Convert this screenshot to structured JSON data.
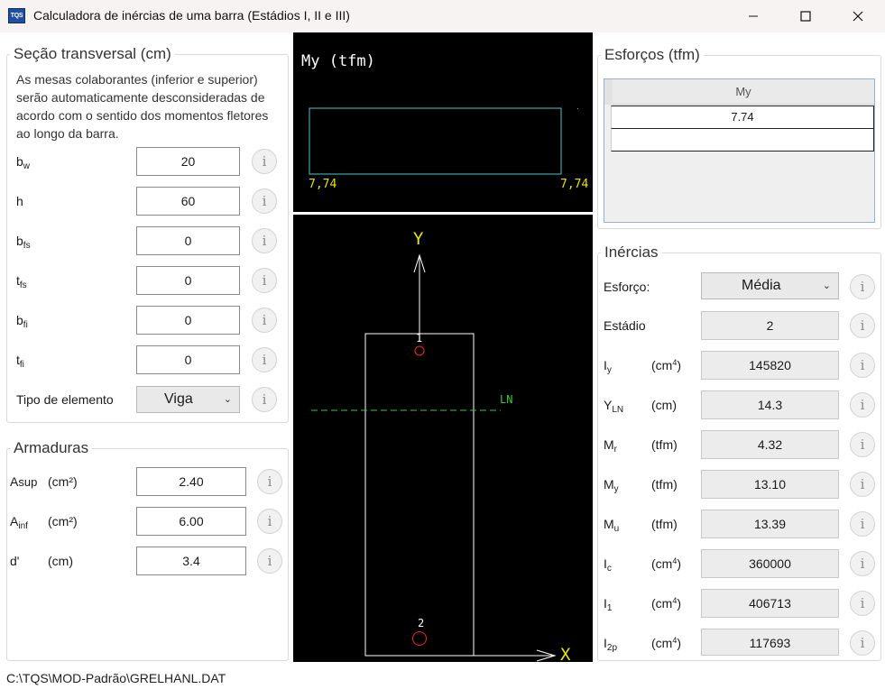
{
  "window": {
    "title": "Calculadora de inércias de uma barra (Estádios I, II e III)",
    "icon_text": "TQS"
  },
  "secao": {
    "title": "Seção transversal (cm)",
    "description": [
      "As mesas colaborantes (inferior e superior)",
      "serão automaticamente desconsideradas de",
      "acordo com o sentido dos momentos fletores",
      "ao longo da barra."
    ],
    "fields": [
      {
        "base": "b",
        "sub": "w",
        "value": "20"
      },
      {
        "base": "h",
        "sub": "",
        "value": "60"
      },
      {
        "base": "b",
        "sub": "fs",
        "value": "0"
      },
      {
        "base": "t",
        "sub": "fs",
        "value": "0"
      },
      {
        "base": "b",
        "sub": "fi",
        "value": "0"
      },
      {
        "base": "t",
        "sub": "fi",
        "value": "0"
      }
    ],
    "tipo_label": "Tipo de elemento",
    "tipo_value": "Viga"
  },
  "armaduras": {
    "title": "Armaduras",
    "rows": [
      {
        "base": "A",
        "sub": "sup",
        "unit": "(cm²)",
        "value": "2.40"
      },
      {
        "base": "A",
        "sub": "inf",
        "unit": "(cm²)",
        "value": "6.00"
      },
      {
        "base": "d'",
        "sub": "",
        "unit": "(cm)",
        "value": "3.4"
      }
    ]
  },
  "diagram": {
    "title": "My (tfm)",
    "left_value": "7,74",
    "right_value": "7,74"
  },
  "section_view": {
    "y_label": "Y",
    "x_label": "X",
    "ln_label": "LN",
    "point1": "1",
    "point2": "2"
  },
  "esforcos": {
    "title": "Esforços (tfm)",
    "column": "My",
    "value": "7.74"
  },
  "inercias": {
    "title": "Inércias",
    "esforco_label": "Esforço:",
    "esforco_value": "Média",
    "estadio_label": "Estádio",
    "estadio_value": "2",
    "rows": [
      {
        "base": "I",
        "sub": "y",
        "unit": "(cm",
        "unit_sup": "4",
        "value": "145820"
      },
      {
        "base": "Y",
        "sub": "LN",
        "unit": "(cm)",
        "unit_sup": "",
        "value": "14.3"
      },
      {
        "base": "M",
        "sub": "r",
        "unit": "(tfm)",
        "unit_sup": "",
        "value": "4.32"
      },
      {
        "base": "M",
        "sub": "y",
        "unit": "(tfm)",
        "unit_sup": "",
        "value": "13.10"
      },
      {
        "base": "M",
        "sub": "u",
        "unit": "(tfm)",
        "unit_sup": "",
        "value": "13.39"
      },
      {
        "base": "I",
        "sub": "c",
        "unit": "(cm",
        "unit_sup": "4",
        "value": "360000"
      },
      {
        "base": "I",
        "sub": "1",
        "unit": "(cm",
        "unit_sup": "4",
        "value": "406713"
      },
      {
        "base": "I",
        "sub": "2p",
        "unit": "(cm",
        "unit_sup": "4",
        "value": "117693"
      }
    ]
  },
  "status_path": "C:\\TQS\\MOD-Padrão\\GRELHANL.DAT",
  "icons": [
    "app-icon",
    "minimize-icon",
    "maximize-icon",
    "close-icon",
    "info-icon",
    "chevron-down-icon"
  ]
}
